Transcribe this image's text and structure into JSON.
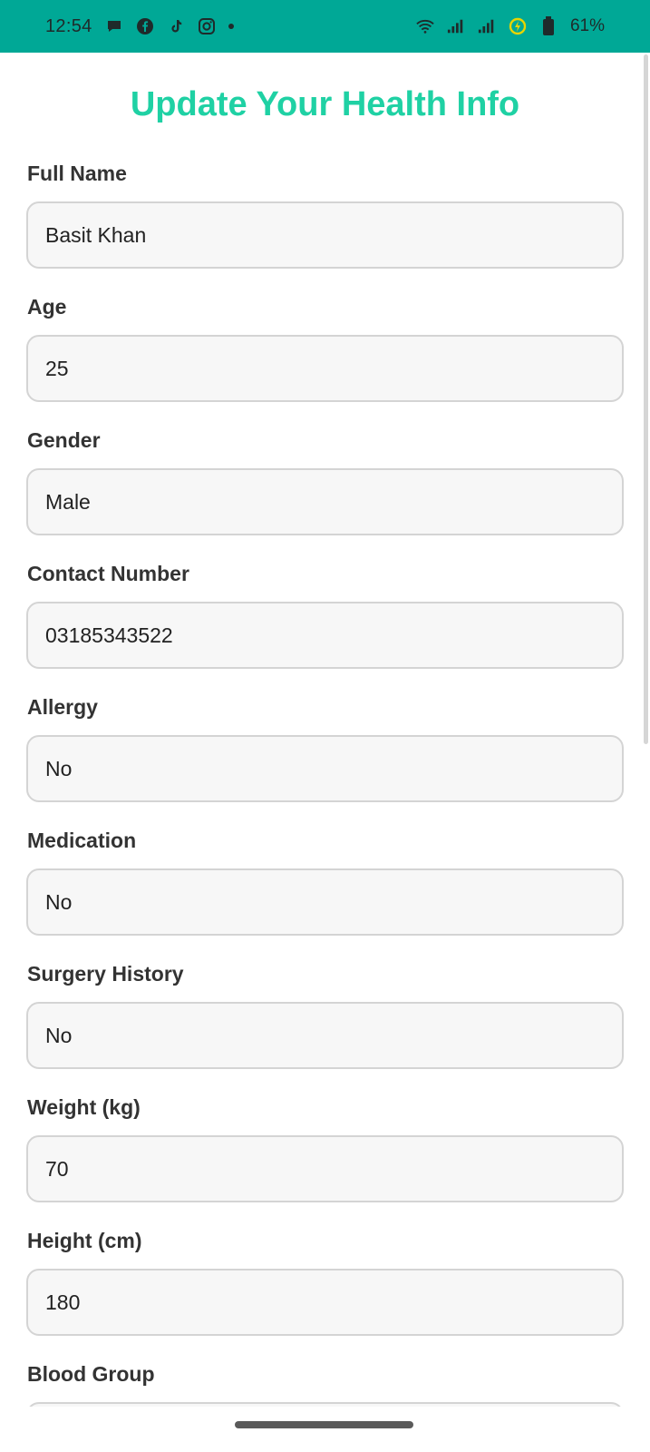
{
  "status_bar": {
    "time": "12:54",
    "battery": "61%",
    "icons_left": [
      "chat-bubble-icon",
      "facebook-icon",
      "tiktok-icon",
      "instagram-icon",
      "notification-dot-icon"
    ],
    "icons_right": [
      "wifi-icon",
      "signal-icon",
      "signal-icon-2",
      "data-saver-icon",
      "battery-icon"
    ]
  },
  "page": {
    "title": "Update Your Health Info"
  },
  "form": {
    "fields": [
      {
        "label": "Full Name",
        "value": "Basit Khan"
      },
      {
        "label": "Age",
        "value": "25"
      },
      {
        "label": "Gender",
        "value": "Male"
      },
      {
        "label": "Contact Number",
        "value": "03185343522"
      },
      {
        "label": "Allergy",
        "value": "No"
      },
      {
        "label": "Medication",
        "value": "No"
      },
      {
        "label": "Surgery History",
        "value": "No"
      },
      {
        "label": "Weight (kg)",
        "value": "70"
      },
      {
        "label": "Height (cm)",
        "value": "180"
      },
      {
        "label": "Blood Group",
        "value": ""
      }
    ]
  },
  "colors": {
    "status_bar_bg": "#00a896",
    "title": "#1fd1a4",
    "input_bg": "#f7f7f7",
    "input_border": "#d4d4d4"
  }
}
